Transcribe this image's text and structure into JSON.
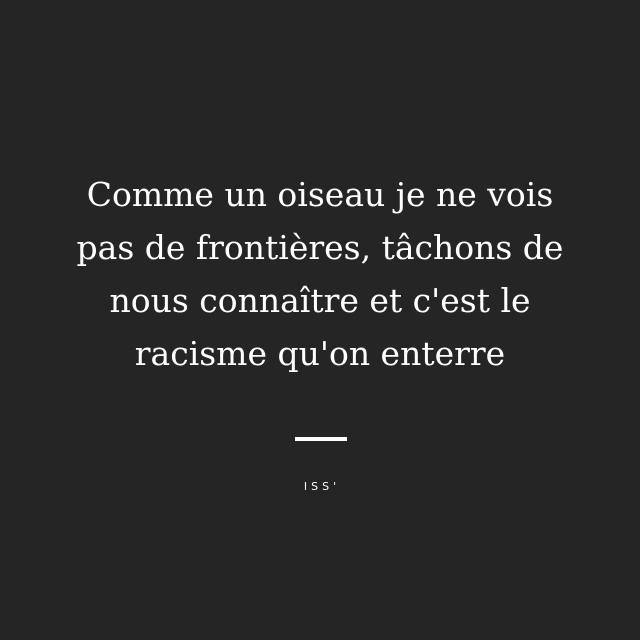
{
  "quote": {
    "lines": [
      "Comme un oiseau je ne vois",
      "pas de frontières, tâchons de",
      "nous connaître et c'est le",
      "racisme qu'on enterre"
    ]
  },
  "author": "ISS'",
  "colors": {
    "background": "#252525",
    "text": "#ffffff"
  }
}
